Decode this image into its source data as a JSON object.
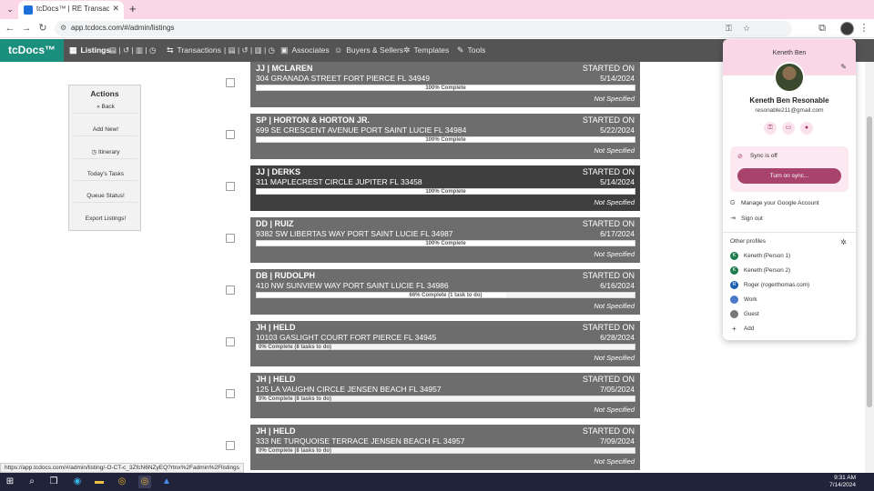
{
  "browser": {
    "tab_title": "tcDocs™ | RE Transaction Mana",
    "url": "app.tcdocs.com/#/admin/listings"
  },
  "app": {
    "logo": "tcDocs™",
    "nav": {
      "listings": "Listings",
      "transactions": "Transactions",
      "associates": "Associates",
      "buyers_sellers": "Buyers & Sellers",
      "templates": "Templates",
      "tools": "Tools"
    }
  },
  "actions": {
    "title": "Actions",
    "items": [
      "« Back",
      "Add New!",
      "Itinerary",
      "Today's Tasks",
      "Queue Status!",
      "Export Listings!"
    ]
  },
  "listings": [
    {
      "agent": "JJ | MCLAREN",
      "address": "304 GRANADA STREET FORT PIERCE FL 34949",
      "started_label": "STARTED ON",
      "date": "5/14/2024",
      "progress_text": "100% Complete",
      "progress": 1.0,
      "status": "Not Specified",
      "dark": false
    },
    {
      "agent": "SP | HORTON & HORTON JR.",
      "address": "699 SE CRESCENT AVENUE PORT SAINT LUCIE FL 34984",
      "started_label": "STARTED ON",
      "date": "5/22/2024",
      "progress_text": "100% Complete",
      "progress": 1.0,
      "status": "Not Specified",
      "dark": false
    },
    {
      "agent": "JJ | DERKS",
      "address": "311 MAPLECREST CIRCLE JUPITER FL 33458",
      "started_label": "STARTED ON",
      "date": "5/14/2024",
      "progress_text": "100% Complete",
      "progress": 1.0,
      "status": "Not Specified",
      "dark": true
    },
    {
      "agent": "DD | RUIZ",
      "address": "9382 SW LIBERTAS WAY PORT SAINT LUCIE FL 34987",
      "started_label": "STARTED ON",
      "date": "6/17/2024",
      "progress_text": "100% Complete",
      "progress": 1.0,
      "status": "Not Specified",
      "dark": false
    },
    {
      "agent": "DB | RUDOLPH",
      "address": "410 NW SUNVIEW WAY PORT SAINT LUCIE FL 34986",
      "started_label": "STARTED ON",
      "date": "6/16/2024",
      "progress_text": "66% Complete (1 task to do)",
      "progress": 0.66,
      "status": "Not Specified",
      "dark": false
    },
    {
      "agent": "JH | HELD",
      "address": "10103 GASLIGHT COURT FORT PIERCE FL 34945",
      "started_label": "STARTED ON",
      "date": "6/28/2024",
      "progress_text": "0% Complete (8 tasks to do)",
      "progress": 0.0,
      "status": "Not Specified",
      "dark": false
    },
    {
      "agent": "JH | HELD",
      "address": "125 LA VAUGHN CIRCLE JENSEN BEACH FL 34957",
      "started_label": "STARTED ON",
      "date": "7/05/2024",
      "progress_text": "0% Complete (8 tasks to do)",
      "progress": 0.0,
      "status": "Not Specified",
      "dark": false
    },
    {
      "agent": "JH | HELD",
      "address": "333 NE TURQUOISE TERRACE JENSEN BEACH FL 34957",
      "started_label": "STARTED ON",
      "date": "7/09/2024",
      "progress_text": "0% Complete (8 tasks to do)",
      "progress": 0.0,
      "status": "Not Specified",
      "dark": false
    }
  ],
  "profile_popup": {
    "name_top": "Keneth Ben",
    "full_name": "Keneth Ben Resonable",
    "email": "resonable211@gmail.com",
    "sync_status": "Sync is off",
    "sync_button": "Turn on sync...",
    "manage_account": "Manage your Google Account",
    "sign_out": "Sign out",
    "other_profiles_label": "Other profiles",
    "profiles": [
      {
        "initial": "K",
        "name": "Keneth (Person 1)",
        "color": "#1e7d4f"
      },
      {
        "initial": "K",
        "name": "Keneth (Person 2)",
        "color": "#1e7d4f"
      },
      {
        "initial": "R",
        "name": "Roger (rogerthomas.com)",
        "color": "#1a5fb4"
      },
      {
        "initial": "",
        "name": "Work",
        "color": "#4a79c9"
      },
      {
        "initial": "",
        "name": "Guest",
        "color": "#777777"
      },
      {
        "initial": "+",
        "name": "Add",
        "color": "#ffffff"
      }
    ]
  },
  "status_url": "https://app.tcdocs.com/#/admin/listing/-O-CT-c_3ZfcN6NZyEQ?rtnx%2Fadmin%2Flistings",
  "taskbar": {
    "time": "9:31 AM",
    "date": "7/14/2024"
  }
}
